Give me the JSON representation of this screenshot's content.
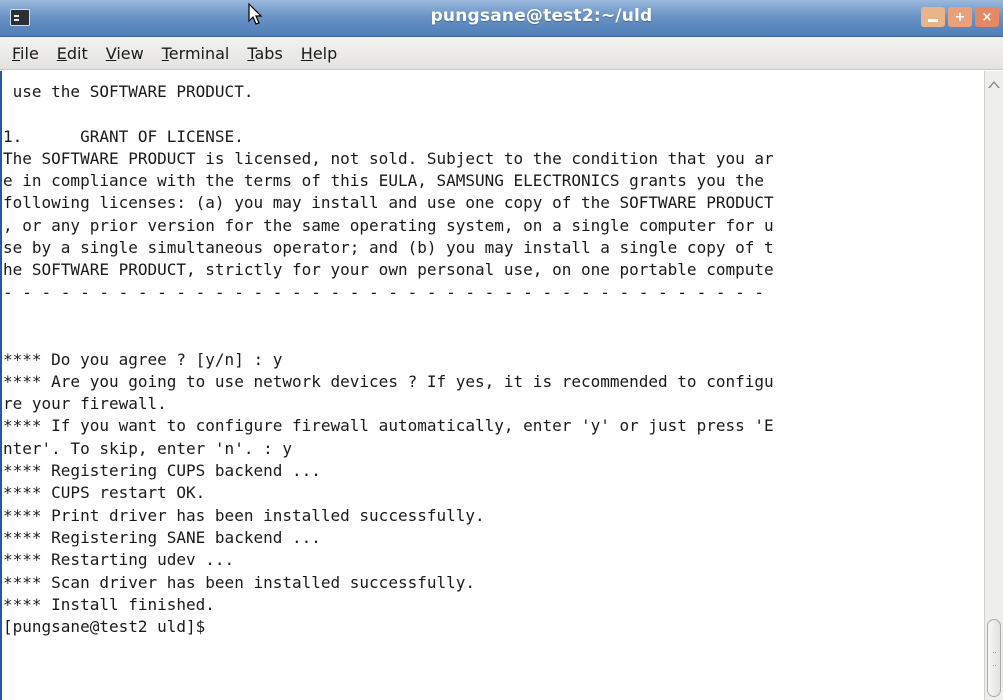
{
  "window": {
    "title": "pungsane@test2:~/uld",
    "buttons": {
      "minimize": "minimize",
      "maximize": "+",
      "close": "×"
    }
  },
  "menu": [
    {
      "label": "File"
    },
    {
      "label": "Edit"
    },
    {
      "label": "View"
    },
    {
      "label": "Terminal"
    },
    {
      "label": "Tabs"
    },
    {
      "label": "Help"
    }
  ],
  "terminal": {
    "lines": [
      " use the SOFTWARE PRODUCT.",
      "",
      "1.      GRANT OF LICENSE.",
      "The SOFTWARE PRODUCT is licensed, not sold. Subject to the condition that you ar",
      "e in compliance with the terms of this EULA, SAMSUNG ELECTRONICS grants you the",
      "following licenses: (a) you may install and use one copy of the SOFTWARE PRODUCT",
      ", or any prior version for the same operating system, on a single computer for u",
      "se by a single simultaneous operator; and (b) you may install a single copy of t",
      "he SOFTWARE PRODUCT, strictly for your own personal use, on one portable compute",
      "- - - - - - - - - - - - - - - - - - - - - - - - - - - - - - - - - - - - - - - -",
      "",
      "",
      "**** Do you agree ? [y/n] : y",
      "**** Are you going to use network devices ? If yes, it is recommended to configu",
      "re your firewall.",
      "**** If you want to configure firewall automatically, enter 'y' or just press 'E",
      "nter'. To skip, enter 'n'. : y",
      "**** Registering CUPS backend ...",
      "**** CUPS restart OK.",
      "**** Print driver has been installed successfully.",
      "**** Registering SANE backend ...",
      "**** Restarting udev ...",
      "**** Scan driver has been installed successfully.",
      "**** Install finished.",
      "[pungsane@test2 uld]$ "
    ]
  },
  "colors": {
    "titlebar": "#6a93c6",
    "menubar": "#e9e8e6",
    "terminal_bg": "#ffffff",
    "terminal_fg": "#1a1a1a"
  }
}
